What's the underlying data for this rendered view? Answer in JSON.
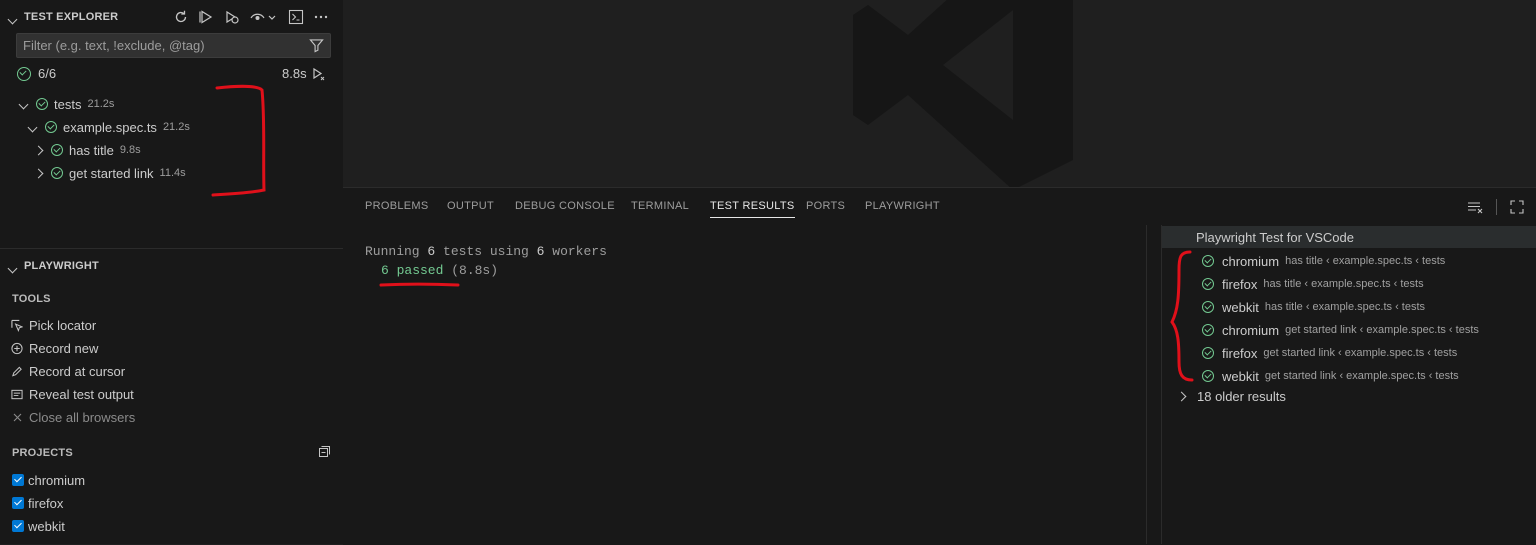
{
  "test_explorer": {
    "title": "TEST EXPLORER",
    "toolbar_icons": [
      "refresh-icon",
      "run-all-icon",
      "debug-all-icon",
      "watch-icon",
      "terminal-icon",
      "more-icon"
    ],
    "filter_placeholder": "Filter (e.g. text, !exclude, @tag)",
    "summary_count": "6/6",
    "summary_duration": "8.8s",
    "tree": [
      {
        "label": "tests",
        "duration": "21.2s"
      },
      {
        "label": "example.spec.ts",
        "duration": "21.2s"
      },
      {
        "label": "has title",
        "duration": "9.8s"
      },
      {
        "label": "get started link",
        "duration": "11.4s"
      }
    ]
  },
  "playwright": {
    "title": "PLAYWRIGHT",
    "tools_heading": "TOOLS",
    "tools": [
      {
        "label": "Pick locator",
        "icon": "pick-locator-icon"
      },
      {
        "label": "Record new",
        "icon": "record-new-icon"
      },
      {
        "label": "Record at cursor",
        "icon": "record-cursor-icon"
      },
      {
        "label": "Reveal test output",
        "icon": "reveal-output-icon"
      },
      {
        "label": "Close all browsers",
        "icon": "close-icon"
      }
    ],
    "projects_heading": "PROJECTS",
    "projects": [
      {
        "label": "chromium",
        "checked": true
      },
      {
        "label": "firefox",
        "checked": true
      },
      {
        "label": "webkit",
        "checked": true
      }
    ]
  },
  "panel": {
    "tabs": [
      "PROBLEMS",
      "OUTPUT",
      "DEBUG CONSOLE",
      "TERMINAL",
      "TEST RESULTS",
      "PORTS",
      "PLAYWRIGHT"
    ],
    "active_tab": "TEST RESULTS",
    "output": {
      "running_prefix": "Running ",
      "running_count": "6",
      "running_mid": " tests using ",
      "worker_count": "6",
      "running_suffix": " workers",
      "passed_text": "6 passed",
      "passed_duration": " (8.8s)"
    },
    "results": {
      "header": "Playwright Test for VSCode",
      "items": [
        {
          "name": "chromium",
          "path": "has title ‹ example.spec.ts ‹ tests"
        },
        {
          "name": "firefox",
          "path": "has title ‹ example.spec.ts ‹ tests"
        },
        {
          "name": "webkit",
          "path": "has title ‹ example.spec.ts ‹ tests"
        },
        {
          "name": "chromium",
          "path": "get started link ‹ example.spec.ts ‹ tests"
        },
        {
          "name": "firefox",
          "path": "get started link ‹ example.spec.ts ‹ tests"
        },
        {
          "name": "webkit",
          "path": "get started link ‹ example.spec.ts ‹ tests"
        }
      ],
      "older": "18 older results"
    }
  },
  "colors": {
    "pass_green": "#73c991",
    "annotation_red": "#e0101a",
    "checkbox_blue": "#0078d4"
  }
}
